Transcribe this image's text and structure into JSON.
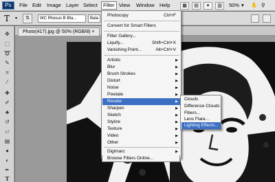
{
  "app": {
    "logo": "Ps"
  },
  "menubar": {
    "items": [
      "File",
      "Edit",
      "Image",
      "Layer",
      "Select",
      "Filter",
      "View",
      "Window",
      "Help"
    ],
    "zoom": "50%"
  },
  "options": {
    "font_family": "WC Rhesus B Bta...",
    "font_style": "Bala"
  },
  "document": {
    "tab_title": "Photo(417).jpg @ 50% (RGB/8) ×"
  },
  "filter_menu": {
    "items": [
      {
        "label": "Photocopy",
        "shortcut": "Ctrl+F"
      },
      {
        "label": "Convert for Smart Filters"
      },
      {
        "label": "Filter Gallery..."
      },
      {
        "label": "Liquify...",
        "shortcut": "Shift+Ctrl+X"
      },
      {
        "label": "Vanishing Point...",
        "shortcut": "Alt+Ctrl+V"
      },
      {
        "label": "Artistic"
      },
      {
        "label": "Blur"
      },
      {
        "label": "Brush Strokes"
      },
      {
        "label": "Distort"
      },
      {
        "label": "Noise"
      },
      {
        "label": "Pixelate"
      },
      {
        "label": "Render"
      },
      {
        "label": "Sharpen"
      },
      {
        "label": "Sketch"
      },
      {
        "label": "Stylize"
      },
      {
        "label": "Texture"
      },
      {
        "label": "Video"
      },
      {
        "label": "Other"
      },
      {
        "label": "Digimarc"
      },
      {
        "label": "Browse Filters Online..."
      }
    ],
    "highlighted": "Render"
  },
  "render_submenu": {
    "items": [
      "Clouds",
      "Difference Clouds",
      "Fibers...",
      "Lens Flare...",
      "Lighting Effects..."
    ],
    "highlighted": "Lighting Effects..."
  },
  "colors": {
    "menu_highlight": "#3a6fc4",
    "workspace": "#9a9a9a",
    "logo_bg": "#12335c"
  }
}
